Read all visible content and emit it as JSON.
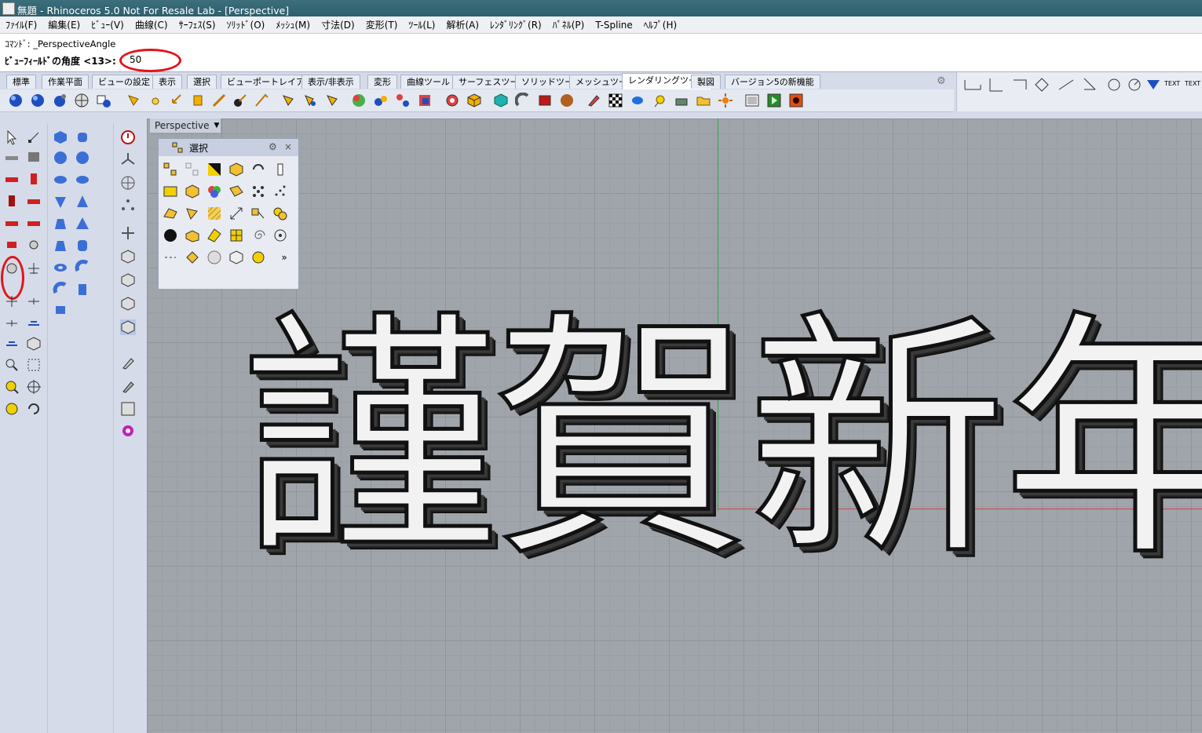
{
  "window": {
    "title": "無題 - Rhinoceros 5.0 Not For Resale Lab - [Perspective]"
  },
  "menu": [
    "ﾌｧｲﾙ(F)",
    "編集(E)",
    "ﾋﾞｭｰ(V)",
    "曲線(C)",
    "ｻｰﾌｪｽ(S)",
    "ｿﾘｯﾄﾞ(O)",
    "ﾒｯｼｭ(M)",
    "寸法(D)",
    "変形(T)",
    "ﾂｰﾙ(L)",
    "解析(A)",
    "ﾚﾝﾀﾞﾘﾝｸﾞ(R)",
    "ﾊﾟﾈﾙ(P)",
    "T-Spline",
    "ﾍﾙﾌﾟ(H)"
  ],
  "command": {
    "history": "ｺﾏﾝﾄﾞ: _PerspectiveAngle",
    "prompt": "ﾋﾞｭｰﾌｨｰﾙﾄﾞの角度 <13>:",
    "input_value": "50"
  },
  "tabs": [
    "標準",
    "作業平面",
    "ビューの設定",
    "表示",
    "選択",
    "ビューポートレイアウト",
    "表示/非表示",
    "変形",
    "曲線ツール",
    "サーフェスツール",
    "ソリッドツール",
    "メッシュツール",
    "レンダリングツール",
    "製図",
    "バージョン5の新機能"
  ],
  "active_tab": "レンダリングツール",
  "viewport": {
    "label": "Perspective",
    "text_chars": [
      "謹",
      "賀",
      "新",
      "年"
    ]
  },
  "panel": {
    "title": "選択",
    "more": "»"
  },
  "right_tools": {
    "text1": "TEXT",
    "text2": "TEXT"
  },
  "colors": {
    "highlight": "#e0151a",
    "x_axis": "#d04444",
    "y_axis": "#2aa84a"
  }
}
